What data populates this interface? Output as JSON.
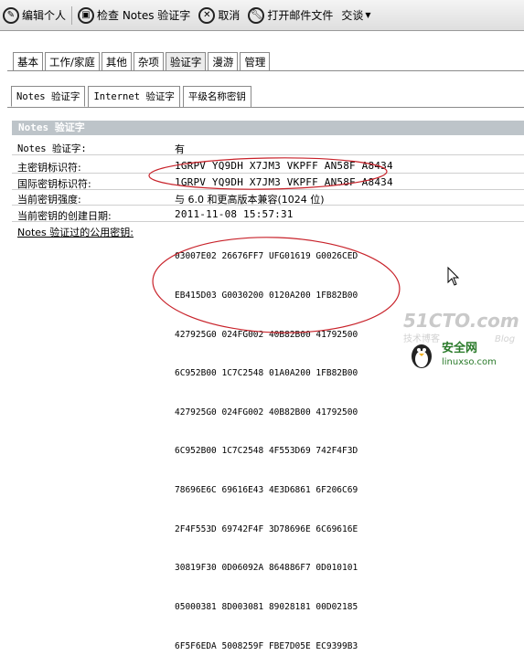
{
  "toolbar": {
    "edit_personal": "编辑个人",
    "check_notes_id": "检查 Notes 验证字",
    "cancel": "取消",
    "open_mail_file": "打开邮件文件",
    "interop": "交谈"
  },
  "top_tabs": [
    "基本",
    "工作/家庭",
    "其他",
    "杂项",
    "验证字",
    "漫游",
    "管理"
  ],
  "top_tabs_active": "验证字",
  "sub_tabs": [
    "Notes 验证字",
    "Internet 验证字",
    "平级名称密钥"
  ],
  "sub_tabs_active": "Notes 验证字",
  "section": {
    "title": "Notes 验证字",
    "rows": [
      {
        "label": "Notes 验证字:",
        "value": "有"
      },
      {
        "label": "主密钥标识符:",
        "value": "1GRPV YQ9DH X7JM3 VKPFF AN58F A8434"
      },
      {
        "label": "国际密钥标识符:",
        "value": "1GRPV YQ9DH X7JM3 VKPFF AN58F A8434"
      },
      {
        "label": "当前密钥强度:",
        "value": "与 6.0 和更高版本兼容(1024 位)"
      },
      {
        "label": "当前密钥的创建日期:",
        "value": "2011-11-08 15:57:31"
      },
      {
        "label": "Notes 验证过的公用密钥:",
        "value": ""
      }
    ],
    "public_key_lines": [
      "03007E02 26676FF7 UFG01619 G0026CED",
      "EB415D03 G0030200 0120A200 1FB82B00",
      "427925G0 024FG002 40B82B00 41792500",
      "6C952B00 1C7C2548 01A0A200 1FB82B00",
      "427925G0 024FG002 40B82B00 41792500",
      "6C952B00 1C7C2548 4F553D69 742F4F3D",
      "78696E6C 69616E43 4E3D6861 6F206C69",
      "2F4F553D 69742F4F 3D78696E 6C69616E",
      "30819F30 0D06092A 864886F7 0D010101",
      "05000381 8D003081 89028181 00D02185",
      "6F5F6EDA 5008259F FBE7D05E EC9399B3"
    ]
  },
  "watermark": {
    "site": "51CTO.com",
    "site2": "技术博客",
    "brand": "安全网",
    "domain": "linuxso.com",
    "blog": "Blog"
  }
}
